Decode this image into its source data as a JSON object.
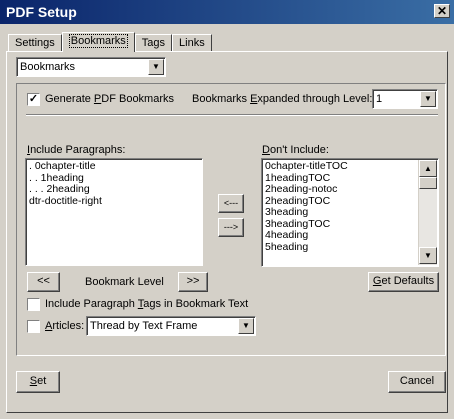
{
  "window": {
    "title": "PDF Setup",
    "close_glyph": "✕"
  },
  "tabs": [
    {
      "label": "Settings"
    },
    {
      "label": "Bookmarks"
    },
    {
      "label": "Tags"
    },
    {
      "label": "Links"
    }
  ],
  "page_select": {
    "value": "Bookmarks"
  },
  "generate": {
    "checked": true,
    "label_pre": "Generate ",
    "label_u": "P",
    "label_post": "DF Bookmarks"
  },
  "expanded": {
    "label_pre": "Bookmarks ",
    "label_u": "E",
    "label_post": "xpanded through Level:",
    "value": "1"
  },
  "include": {
    "label_u": "I",
    "label_post": "nclude Paragraphs:",
    "items": [
      ". 0chapter-title",
      ". . 1heading",
      ". . . 2heading",
      "dtr-doctitle-right"
    ]
  },
  "dont_include": {
    "label_u": "D",
    "label_post": "on't Include:",
    "items": [
      "0chapter-titleTOC",
      "1headingTOC",
      "2heading-notoc",
      "2headingTOC",
      "3heading",
      "3headingTOC",
      "4heading",
      "5heading"
    ]
  },
  "move_left_label": "<---",
  "move_right_label": "--->",
  "level": {
    "prev_label": "<<",
    "label": "Bookmark Level",
    "next_label": ">>"
  },
  "get_defaults": {
    "label_u": "G",
    "label_post": "et Defaults"
  },
  "include_tags": {
    "checked": false,
    "label_pre": "Include Paragraph ",
    "label_u": "T",
    "label_post": "ags in Bookmark Text"
  },
  "articles": {
    "checked": false,
    "label_u": "A",
    "label_post": "rticles:",
    "value": "Thread by Text Frame"
  },
  "footer": {
    "set_u": "S",
    "set_post": "et",
    "cancel_label": "Cancel"
  },
  "icons": {
    "dropdown": "▼",
    "scroll_up": "▲",
    "scroll_down": "▼",
    "check": "✓"
  }
}
